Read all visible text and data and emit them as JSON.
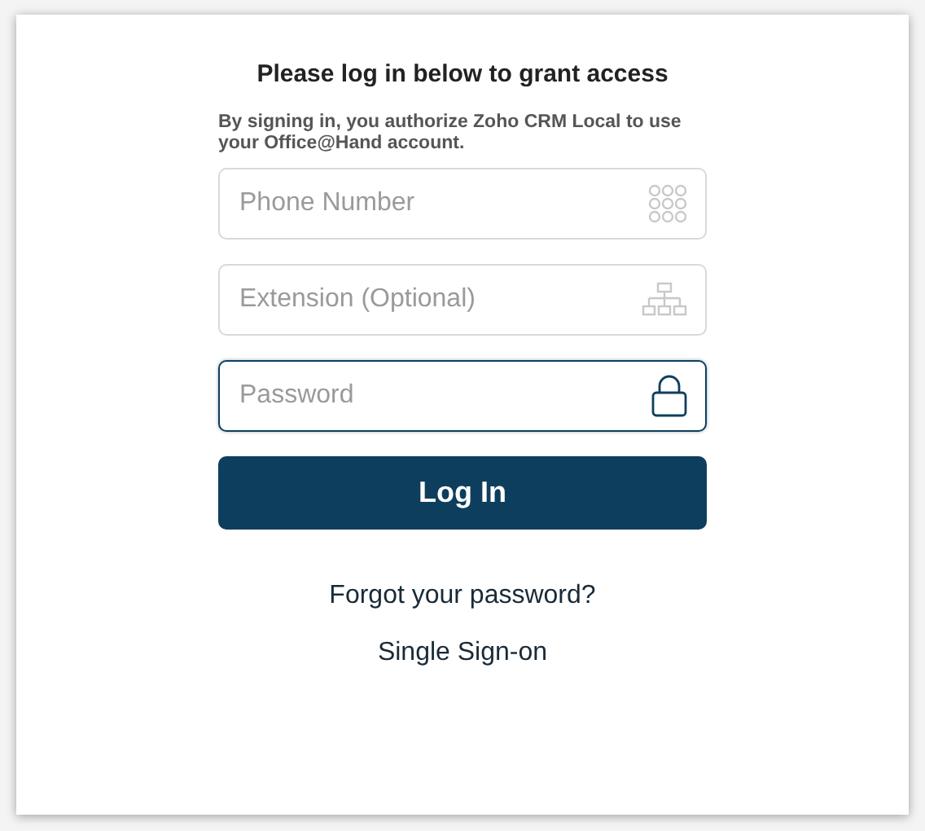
{
  "heading": "Please log in below to grant access",
  "notice": "By signing in, you authorize Zoho CRM Local to use your Office@Hand account.",
  "fields": [
    {
      "kind": "phone",
      "placeholder": "Phone Number",
      "focused": false
    },
    {
      "kind": "extension",
      "placeholder": "Extension (Optional)",
      "focused": false
    },
    {
      "kind": "password",
      "placeholder": "Password",
      "focused": true
    }
  ],
  "login_button": "Log In",
  "links": [
    "Forgot your password?",
    "Single Sign-on"
  ]
}
